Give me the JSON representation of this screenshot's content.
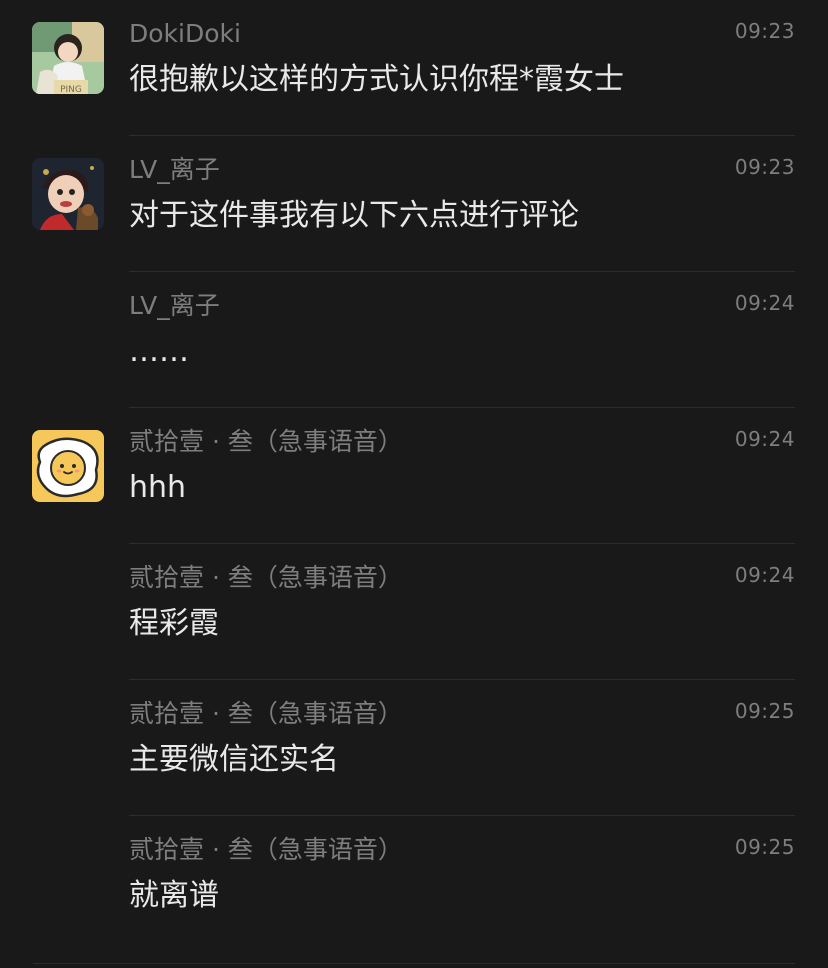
{
  "messages": [
    {
      "name": "DokiDoki",
      "time": "09:23",
      "text": "很抱歉以这样的方式认识你程*霞女士",
      "avatar": "anime-girl-avatar",
      "avatar_label": "PING"
    },
    {
      "name": "LV_离子",
      "time": "09:23",
      "text": "对于这件事我有以下六点进行评论",
      "avatar": "cartoon-face-avatar"
    },
    {
      "name": "LV_离子",
      "time": "09:24",
      "text": "……",
      "avatar": ""
    },
    {
      "name": "贰拾壹 · 叁（急事语音）",
      "time": "09:24",
      "text": "hhh",
      "avatar": "fried-egg-avatar"
    },
    {
      "name": "贰拾壹 · 叁（急事语音）",
      "time": "09:24",
      "text": "程彩霞",
      "avatar": ""
    },
    {
      "name": "贰拾壹 · 叁（急事语音）",
      "time": "09:25",
      "text": "主要微信还实名",
      "avatar": ""
    },
    {
      "name": "贰拾壹 · 叁（急事语音）",
      "time": "09:25",
      "text": "就离谱",
      "avatar": ""
    }
  ],
  "colors": {
    "background": "#191919",
    "name": "#7e7e7e",
    "text": "#e9e9e9",
    "divider": "#2c2c2c",
    "egg_yellow": "#f6c85a"
  }
}
